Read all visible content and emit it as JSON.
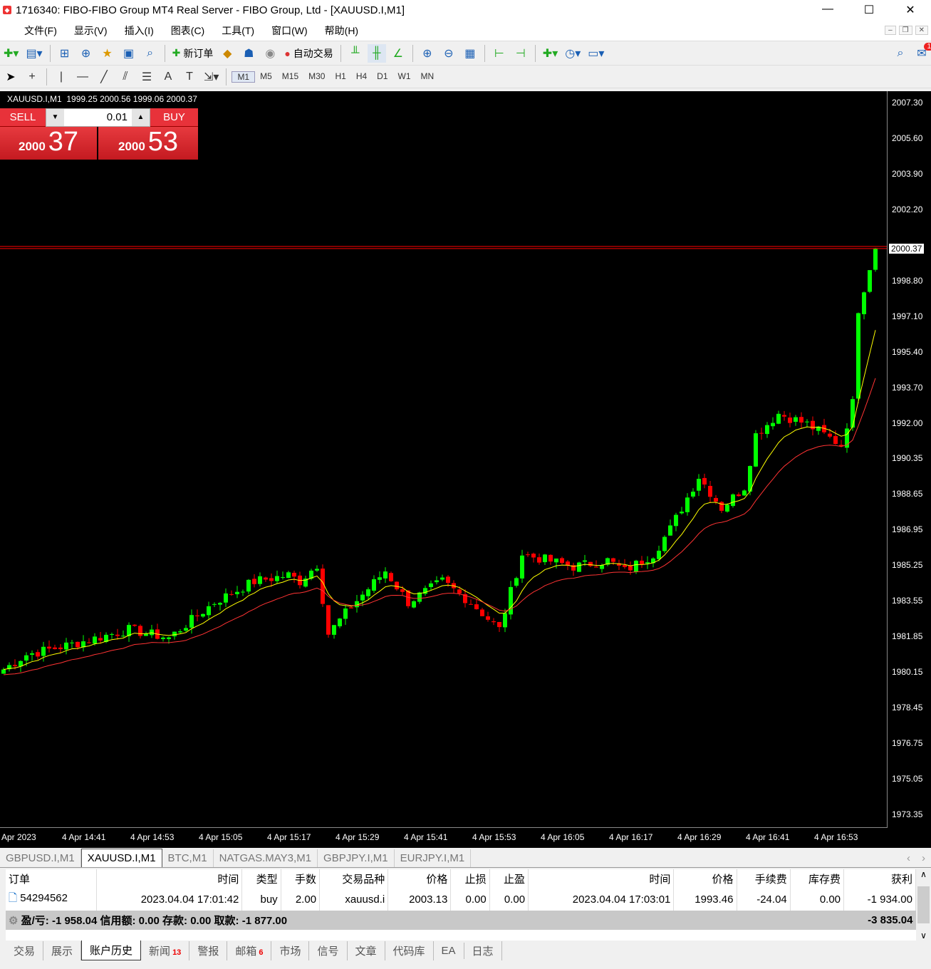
{
  "window": {
    "title": "1716340: FIBO-FIBO Group MT4 Real Server - FIBO Group, Ltd - [XAUUSD.I,M1]",
    "minimize": "—",
    "maximize": "☐",
    "close": "✕"
  },
  "menu": [
    "文件(F)",
    "显示(V)",
    "插入(I)",
    "图表(C)",
    "工具(T)",
    "窗口(W)",
    "帮助(H)"
  ],
  "toolbar": {
    "new_order": "新订单",
    "auto_trade": "自动交易",
    "notif_count": "1"
  },
  "timeframes": [
    "M1",
    "M5",
    "M15",
    "M30",
    "H1",
    "H4",
    "D1",
    "W1",
    "MN"
  ],
  "active_timeframe": "M1",
  "chart": {
    "symbol": "XAUUSD.I,M1",
    "ohlc": "1999.25 2000.56 1999.06 2000.37",
    "sell_label": "SELL",
    "buy_label": "BUY",
    "lot": "0.01",
    "bid_big": "2000",
    "bid_small": "37",
    "ask_big": "2000",
    "ask_small": "53"
  },
  "chart_data": {
    "type": "candlestick",
    "symbol": "XAUUSD.I",
    "timeframe": "M1",
    "y_ticks": [
      "2007.30",
      "2005.60",
      "2003.90",
      "2002.20",
      "1998.80",
      "1997.10",
      "1995.40",
      "1993.70",
      "1992.00",
      "1990.35",
      "1988.65",
      "1986.95",
      "1985.25",
      "1983.55",
      "1981.85",
      "1980.15",
      "1978.45",
      "1976.75",
      "1975.05",
      "1973.35"
    ],
    "ylim": [
      1973.35,
      2007.3
    ],
    "current_price": "2000.37",
    "x_ticks": [
      "Apr 2023",
      "4 Apr 14:41",
      "4 Apr 14:53",
      "4 Apr 15:05",
      "4 Apr 15:17",
      "4 Apr 15:29",
      "4 Apr 15:41",
      "4 Apr 15:53",
      "4 Apr 16:05",
      "4 Apr 16:17",
      "4 Apr 16:29",
      "4 Apr 16:41",
      "4 Apr 16:53"
    ],
    "close_path": [
      [
        0,
        1980.3
      ],
      [
        4,
        1981.0
      ],
      [
        12,
        1981.5
      ],
      [
        22,
        1982.2
      ],
      [
        29,
        1981.8
      ],
      [
        37,
        1983.5
      ],
      [
        44,
        1984.5
      ],
      [
        50,
        1984.8
      ],
      [
        52,
        1984.5
      ],
      [
        55,
        1985.3
      ],
      [
        57,
        1982.0
      ],
      [
        61,
        1983.3
      ],
      [
        67,
        1985.0
      ],
      [
        71,
        1983.5
      ],
      [
        77,
        1984.5
      ],
      [
        82,
        1983.5
      ],
      [
        87,
        1982.2
      ],
      [
        91,
        1985.8
      ],
      [
        100,
        1985.2
      ],
      [
        106,
        1985.5
      ],
      [
        109,
        1985.0
      ],
      [
        114,
        1985.8
      ],
      [
        117,
        1987.0
      ],
      [
        122,
        1989.5
      ],
      [
        126,
        1988.0
      ],
      [
        130,
        1989.0
      ],
      [
        132,
        1991.5
      ],
      [
        136,
        1992.5
      ],
      [
        141,
        1992.0
      ],
      [
        147,
        1991.0
      ],
      [
        149,
        1993.0
      ],
      [
        150,
        1997.5
      ],
      [
        152,
        1999.5
      ],
      [
        153,
        2000.37
      ]
    ],
    "series": [
      {
        "name": "MA fast",
        "color": "#ffff00"
      },
      {
        "name": "MA slow",
        "color": "#ff3333"
      }
    ]
  },
  "symbol_tabs": [
    "GBPUSD.I,M1",
    "XAUUSD.I,M1",
    "BTC,M1",
    "NATGAS.MAY3,M1",
    "GBPJPY.I,M1",
    "EURJPY.I,M1"
  ],
  "terminal": {
    "headers": [
      "订单",
      "时间",
      "类型",
      "手数",
      "交易品种",
      "价格",
      "止损",
      "止盈",
      "时间",
      "价格",
      "手续费",
      "库存费",
      "获利"
    ],
    "rows": [
      [
        "54294562",
        "2023.04.04 17:01:42",
        "buy",
        "2.00",
        "xauusd.i",
        "2003.13",
        "0.00",
        "0.00",
        "2023.04.04 17:03:01",
        "1993.46",
        "-24.04",
        "0.00",
        "-1 934.00"
      ]
    ],
    "summary": "盈/亏: -1 958.04  信用额: 0.00  存款: 0.00  取款: -1 877.00",
    "summary_total": "-3 835.04"
  },
  "bottom_tabs": [
    {
      "label": "交易"
    },
    {
      "label": "展示"
    },
    {
      "label": "账户历史"
    },
    {
      "label": "新闻",
      "badge": "13"
    },
    {
      "label": "警报"
    },
    {
      "label": "邮箱",
      "badge": "6"
    },
    {
      "label": "市场"
    },
    {
      "label": "信号"
    },
    {
      "label": "文章"
    },
    {
      "label": "代码库"
    },
    {
      "label": "EA"
    },
    {
      "label": "日志"
    }
  ],
  "colors": {
    "bull": "#00ff00",
    "bear": "#ff0000",
    "accent": "#e8323a"
  }
}
